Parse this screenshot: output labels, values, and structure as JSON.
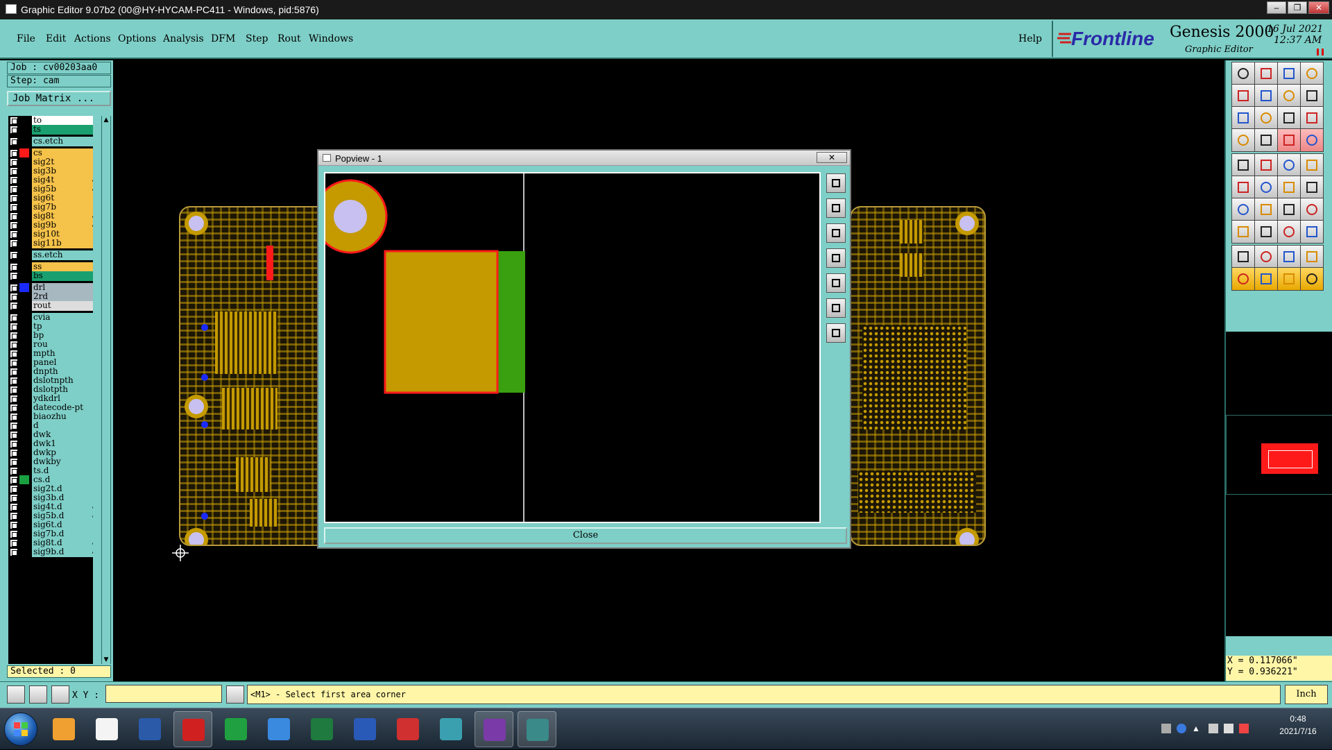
{
  "window": {
    "title": "Graphic Editor 9.07b2 (00@HY-HYCAM-PC411 - Windows, pid:5876)",
    "controls": [
      "–",
      "❐",
      "✕"
    ]
  },
  "menu": {
    "items": [
      "File",
      "Edit",
      "Actions",
      "Options",
      "Analysis",
      "DFM",
      "Step",
      "Rout",
      "Windows"
    ],
    "help": "Help"
  },
  "logo": {
    "brand": "Frontline",
    "product": "Genesis 2000",
    "subtitle": "Graphic Editor",
    "date": "16 Jul 2021",
    "time": "12:37 AM"
  },
  "left": {
    "job": "Job : cv00203aa0",
    "step": "Step: cam",
    "job_matrix": "Job Matrix ...",
    "selected": "Selected : 0"
  },
  "layers": [
    {
      "name": "to",
      "color": "#ffffff",
      "swatch": "#000000"
    },
    {
      "name": "ts",
      "color": "#1aa070",
      "swatch": "#000000"
    },
    {
      "name": "cs.etch",
      "color": "#7ecfc7",
      "swatch": "#000000"
    },
    {
      "name": "cs",
      "color": "#f5c24a",
      "swatch": "#ff1a1a",
      "mark": "▪"
    },
    {
      "name": "sig2t",
      "color": "#f5c24a",
      "swatch": "#000000"
    },
    {
      "name": "sig3b",
      "color": "#f5c24a",
      "swatch": "#000000"
    },
    {
      "name": "sig4t",
      "color": "#f5c24a",
      "swatch": "#000000",
      "mark": "↙"
    },
    {
      "name": "sig5b",
      "color": "#f5c24a",
      "swatch": "#000000",
      "mark": "↙"
    },
    {
      "name": "sig6t",
      "color": "#f5c24a",
      "swatch": "#000000"
    },
    {
      "name": "sig7b",
      "color": "#f5c24a",
      "swatch": "#000000"
    },
    {
      "name": "sig8t",
      "color": "#f5c24a",
      "swatch": "#000000",
      "mark": "↙"
    },
    {
      "name": "sig9b",
      "color": "#f5c24a",
      "swatch": "#000000",
      "mark": "↙"
    },
    {
      "name": "sig10t",
      "color": "#f5c24a",
      "swatch": "#000000"
    },
    {
      "name": "sig11b",
      "color": "#f5c24a",
      "swatch": "#000000"
    },
    {
      "name": "ss.etch",
      "color": "#7ecfc7",
      "swatch": "#000000"
    },
    {
      "name": "ss",
      "color": "#f5c24a",
      "swatch": "#000000"
    },
    {
      "name": "bs",
      "color": "#1aa070",
      "swatch": "#000000"
    },
    {
      "name": "drl",
      "color": "#a8b8c0",
      "swatch": "#1a2aff"
    },
    {
      "name": "2rd",
      "color": "#a8b8c0",
      "swatch": "#000000"
    },
    {
      "name": "rout",
      "color": "#dddddd",
      "swatch": "#000000"
    },
    {
      "name": "cvia",
      "color": "#7ecfc7",
      "swatch": "#000000"
    },
    {
      "name": "tp",
      "color": "#7ecfc7",
      "swatch": "#000000"
    },
    {
      "name": "bp",
      "color": "#7ecfc7",
      "swatch": "#000000"
    },
    {
      "name": "rou",
      "color": "#7ecfc7",
      "swatch": "#000000"
    },
    {
      "name": "mpth",
      "color": "#7ecfc7",
      "swatch": "#000000"
    },
    {
      "name": "panel",
      "color": "#7ecfc7",
      "swatch": "#000000"
    },
    {
      "name": "dnpth",
      "color": "#7ecfc7",
      "swatch": "#000000"
    },
    {
      "name": "dslotnpth",
      "color": "#7ecfc7",
      "swatch": "#000000"
    },
    {
      "name": "dslotpth",
      "color": "#7ecfc7",
      "swatch": "#000000"
    },
    {
      "name": "ydkdrl",
      "color": "#7ecfc7",
      "swatch": "#000000"
    },
    {
      "name": "datecode-pt",
      "color": "#7ecfc7",
      "swatch": "#000000"
    },
    {
      "name": "biaozhu",
      "color": "#7ecfc7",
      "swatch": "#000000"
    },
    {
      "name": "d",
      "color": "#7ecfc7",
      "swatch": "#000000"
    },
    {
      "name": "dwk",
      "color": "#7ecfc7",
      "swatch": "#000000"
    },
    {
      "name": "dwk1",
      "color": "#7ecfc7",
      "swatch": "#000000"
    },
    {
      "name": "dwkp",
      "color": "#7ecfc7",
      "swatch": "#000000"
    },
    {
      "name": "dwkby",
      "color": "#7ecfc7",
      "swatch": "#000000"
    },
    {
      "name": "ts.d",
      "color": "#7ecfc7",
      "swatch": "#000000"
    },
    {
      "name": "cs.d",
      "color": "#7ecfc7",
      "swatch": "#1aa040"
    },
    {
      "name": "sig2t.d",
      "color": "#7ecfc7",
      "swatch": "#000000"
    },
    {
      "name": "sig3b.d",
      "color": "#7ecfc7",
      "swatch": "#000000"
    },
    {
      "name": "sig4t.d",
      "color": "#7ecfc7",
      "swatch": "#000000",
      "mark": "↙"
    },
    {
      "name": "sig5b.d",
      "color": "#7ecfc7",
      "swatch": "#000000",
      "mark": "↙"
    },
    {
      "name": "sig6t.d",
      "color": "#7ecfc7",
      "swatch": "#000000"
    },
    {
      "name": "sig7b.d",
      "color": "#7ecfc7",
      "swatch": "#000000"
    },
    {
      "name": "sig8t.d",
      "color": "#7ecfc7",
      "swatch": "#000000",
      "mark": "↙"
    },
    {
      "name": "sig9b.d",
      "color": "#7ecfc7",
      "swatch": "#000000",
      "mark": "↙"
    }
  ],
  "popview": {
    "title": "Popview - 1",
    "close_x": "✕",
    "close_button": "Close"
  },
  "coords": {
    "x": "X = 0.117066\"",
    "y": "Y = 0.936221\""
  },
  "status": {
    "xy_label": "X Y :",
    "xy_value": "",
    "message": "<M1> - Select first area corner",
    "units": "Inch"
  },
  "taskbar": {
    "apps": [
      "start",
      "shell",
      "notepad",
      "save",
      "genesis",
      "pads",
      "browser",
      "excel",
      "word",
      "pdf",
      "eye",
      "cam",
      "popview"
    ],
    "clock_time": "0:48",
    "clock_date": "2021/7/16"
  },
  "colors": {
    "panel": "#7ecfc7",
    "copper": "#c49a00",
    "highlight": "#ff1a1a",
    "soldermask": "#3aa010",
    "drill": "#c8c0f0"
  }
}
